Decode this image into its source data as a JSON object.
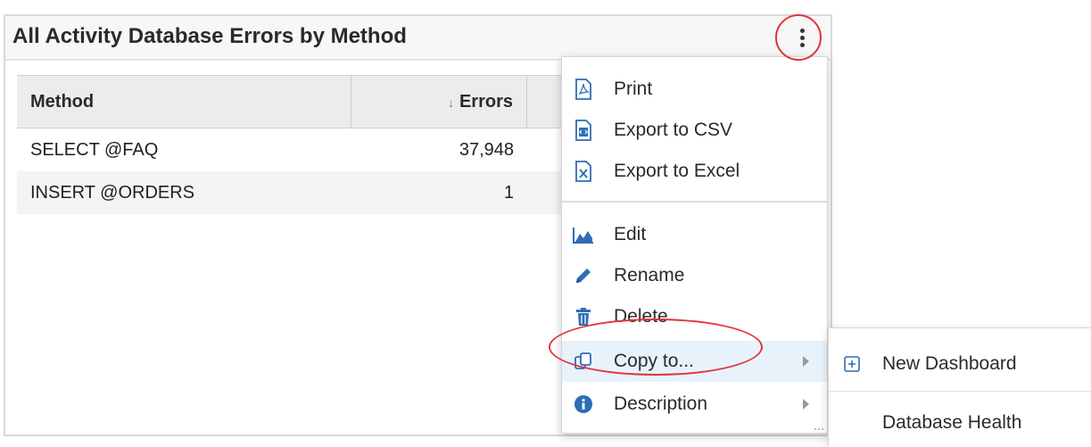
{
  "widget": {
    "title": "All Activity Database Errors by Method"
  },
  "table": {
    "columns": [
      "Method",
      "Errors"
    ],
    "rows": [
      {
        "method": "SELECT @FAQ",
        "errors": "37,948"
      },
      {
        "method": "INSERT @ORDERS",
        "errors": "1"
      }
    ],
    "sort": {
      "column": "Errors",
      "direction": "descending",
      "icon": "sort-down-arrow-icon"
    }
  },
  "menu": {
    "items": [
      {
        "label": "Print",
        "icon": "pdf-file-icon"
      },
      {
        "label": "Export to CSV",
        "icon": "csv-file-icon"
      },
      {
        "label": "Export to Excel",
        "icon": "excel-file-icon"
      },
      {
        "label": "Edit",
        "icon": "area-chart-icon"
      },
      {
        "label": "Rename",
        "icon": "pencil-icon"
      },
      {
        "label": "Delete",
        "icon": "trash-icon"
      },
      {
        "label": "Copy to...",
        "icon": "copy-icon",
        "has_submenu": true,
        "highlighted": true
      },
      {
        "label": "Description",
        "icon": "info-circle-icon",
        "has_submenu": true
      }
    ]
  },
  "submenu": {
    "items": [
      {
        "label": "New Dashboard",
        "icon": "plus-square-icon"
      },
      {
        "label": "Database Health"
      }
    ]
  },
  "colors": {
    "icon_blue": "#2f6db5",
    "annotation_red": "#e2343c",
    "highlight": "#e8f2fb"
  }
}
